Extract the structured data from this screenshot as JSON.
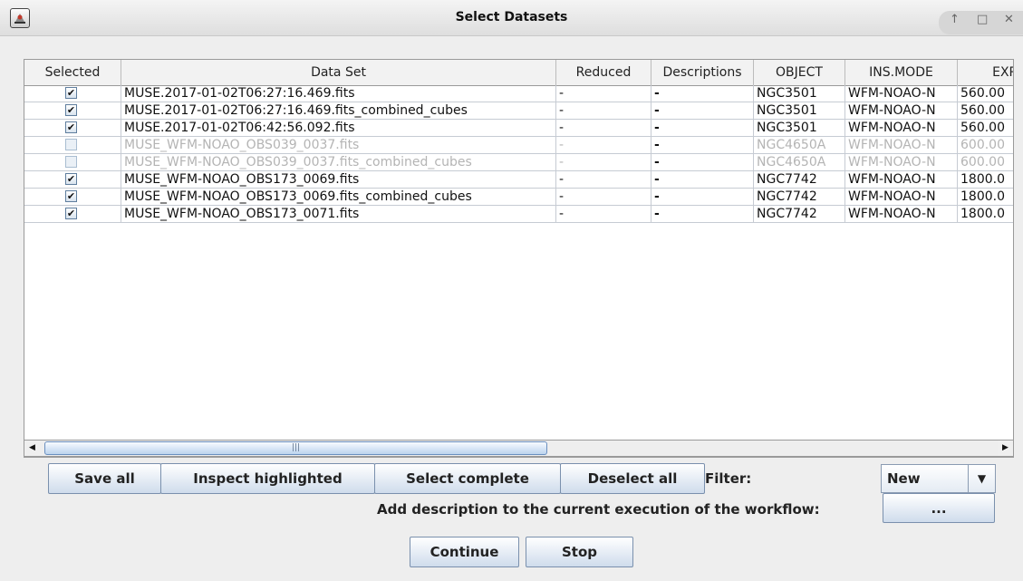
{
  "window": {
    "title": "Select Datasets",
    "controls": [
      "↑",
      "□",
      "✕"
    ]
  },
  "table": {
    "columns": [
      "Selected",
      "Data Set",
      "Reduced",
      "Descriptions",
      "OBJECT",
      "INS.MODE",
      "EXP"
    ],
    "rows": [
      {
        "selected": true,
        "enabled": true,
        "dataset": "MUSE.2017-01-02T06:27:16.469.fits",
        "reduced": "-",
        "descriptions": "-",
        "object": "NGC3501",
        "insmode": "WFM-NOAO-N",
        "exp": "560.00"
      },
      {
        "selected": true,
        "enabled": true,
        "dataset": "MUSE.2017-01-02T06:27:16.469.fits_combined_cubes",
        "reduced": "-",
        "descriptions": "-",
        "object": "NGC3501",
        "insmode": "WFM-NOAO-N",
        "exp": "560.00"
      },
      {
        "selected": true,
        "enabled": true,
        "dataset": "MUSE.2017-01-02T06:42:56.092.fits",
        "reduced": "-",
        "descriptions": "-",
        "object": "NGC3501",
        "insmode": "WFM-NOAO-N",
        "exp": "560.00"
      },
      {
        "selected": false,
        "enabled": false,
        "dataset": "MUSE_WFM-NOAO_OBS039_0037.fits",
        "reduced": "-",
        "descriptions": "-",
        "object": "NGC4650A",
        "insmode": "WFM-NOAO-N",
        "exp": "600.00"
      },
      {
        "selected": false,
        "enabled": false,
        "dataset": "MUSE_WFM-NOAO_OBS039_0037.fits_combined_cubes",
        "reduced": "-",
        "descriptions": "-",
        "object": "NGC4650A",
        "insmode": "WFM-NOAO-N",
        "exp": "600.00"
      },
      {
        "selected": true,
        "enabled": true,
        "dataset": "MUSE_WFM-NOAO_OBS173_0069.fits",
        "reduced": "-",
        "descriptions": "-",
        "object": "NGC7742",
        "insmode": "WFM-NOAO-N",
        "exp": "1800.0"
      },
      {
        "selected": true,
        "enabled": true,
        "dataset": "MUSE_WFM-NOAO_OBS173_0069.fits_combined_cubes",
        "reduced": "-",
        "descriptions": "-",
        "object": "NGC7742",
        "insmode": "WFM-NOAO-N",
        "exp": "1800.0"
      },
      {
        "selected": true,
        "enabled": true,
        "dataset": "MUSE_WFM-NOAO_OBS173_0071.fits",
        "reduced": "-",
        "descriptions": "-",
        "object": "NGC7742",
        "insmode": "WFM-NOAO-N",
        "exp": "1800.0"
      }
    ]
  },
  "scrollbar": {
    "left": "◀",
    "right": "▶",
    "grip": "|||"
  },
  "buttons": {
    "save_all": "Save all",
    "inspect_highlighted": "Inspect highlighted",
    "select_complete": "Select complete",
    "deselect_all": "Deselect all",
    "description": "...",
    "continue": "Continue",
    "stop": "Stop"
  },
  "filter": {
    "label": "Filter:",
    "value": "New",
    "arrow": "▼"
  },
  "description_label": "Add description to the current execution of the workflow:",
  "checkmark": "✔"
}
